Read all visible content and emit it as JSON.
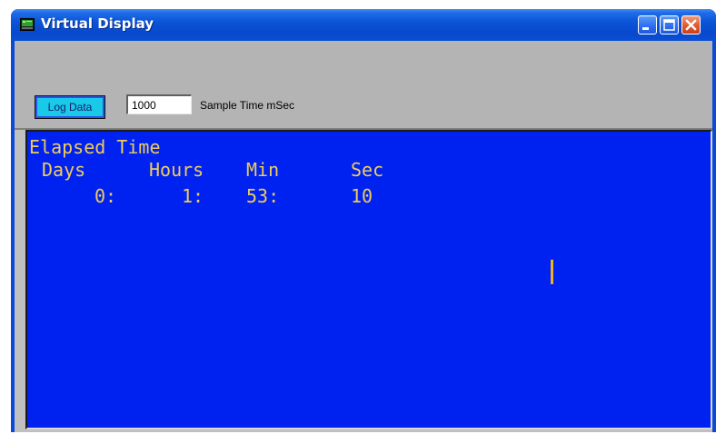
{
  "window": {
    "title": "Virtual Display"
  },
  "toolbar": {
    "log_button_label": "Log Data",
    "sample_time_value": "1000",
    "sample_time_label": "Sample Time mSec"
  },
  "display": {
    "heading": "Elapsed Time",
    "columns": [
      "Days",
      "Hours",
      "Min",
      "Sec"
    ],
    "values": [
      "0:",
      "1:",
      "53:",
      "10"
    ],
    "text_color": "#f0cc5a",
    "background_color": "#0022f0"
  },
  "icons": {
    "app": "app-icon",
    "minimize": "minimize-icon",
    "maximize": "maximize-icon",
    "close": "close-icon"
  }
}
